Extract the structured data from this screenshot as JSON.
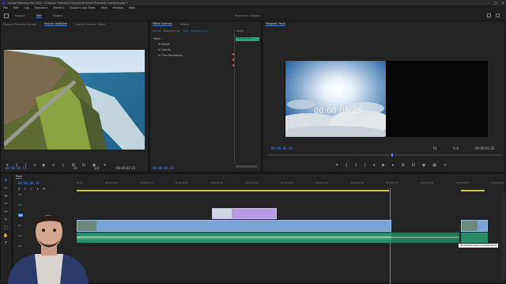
{
  "window": {
    "title": "Adobe Premiere Pro 2022 - E:\\Adobe Premiere Course\\1\\Files\\03 Premiere Course.prproj *",
    "controls": [
      "–",
      "□",
      "✕"
    ]
  },
  "menu": [
    "File",
    "Edit",
    "Clip",
    "Sequence",
    "Markers",
    "Graphics and Titles",
    "View",
    "Window",
    "Help"
  ],
  "workspace": {
    "tabs": [
      "Import",
      "Edit",
      "Export"
    ],
    "active": "Edit",
    "project_title": "Premiere Course"
  },
  "source_panel": {
    "tabs": [
      "Project: Premiere Course",
      "Source: stabilizer",
      "Lumetri Scopes: Stabil"
    ],
    "timecode_in": "00:00:05:11",
    "fit": "Fit",
    "quality": "1/2",
    "timecode_out": "00:00:01:23"
  },
  "effect_controls": {
    "tabs": [
      "Effect Controls",
      "Effects"
    ],
    "master": "Source · Stabilizer.mp4",
    "sequence": "Paris · Stabilizer.mp4",
    "sections": [
      "Video",
      "fx  Motion",
      "fx  Opacity",
      "fx  Time Remapping"
    ],
    "section_labels": [
      "Video",
      "Motion",
      "Opacity",
      "Time Remapping"
    ],
    "clip_timecode": ":00:00",
    "clip_label": "Stabilizer.mp4",
    "timecode": "00:00:06:10"
  },
  "program_panel": {
    "tabs": [
      "Program: Paris"
    ],
    "overlay_timecode": "00:00:06:25",
    "timecode_in": "00:00:06:10",
    "fit": "Fit",
    "quality": "Full",
    "timecode_out": "00:00:01:23"
  },
  "timeline": {
    "tab": "Paris",
    "playhead": "00:00:06:10",
    "ruler_ticks": [
      "00:00",
      "00:00:00:05",
      "00:00:00:10",
      "00:00:00:15",
      "00:00:00:20",
      "00:00:01:00",
      "00:00:01:05",
      "00:00:01:10",
      "00:00:01:15",
      "00:00:01:20",
      "00:00:02:00",
      "00:00:02:05",
      "00:00:02:10"
    ],
    "track_labels": [
      "V3",
      "V2",
      "V1",
      "A1",
      "A2",
      "A3"
    ],
    "tooltip": "00:00:06:10 Sequence 00:00:06:10"
  },
  "colors": {
    "accent_blue": "#3d8bff",
    "clip_video": "#7aa3d6",
    "clip_adjust": "#b59ae6",
    "clip_audio": "#2a8c66",
    "effect_clip": "#1fa67a"
  }
}
